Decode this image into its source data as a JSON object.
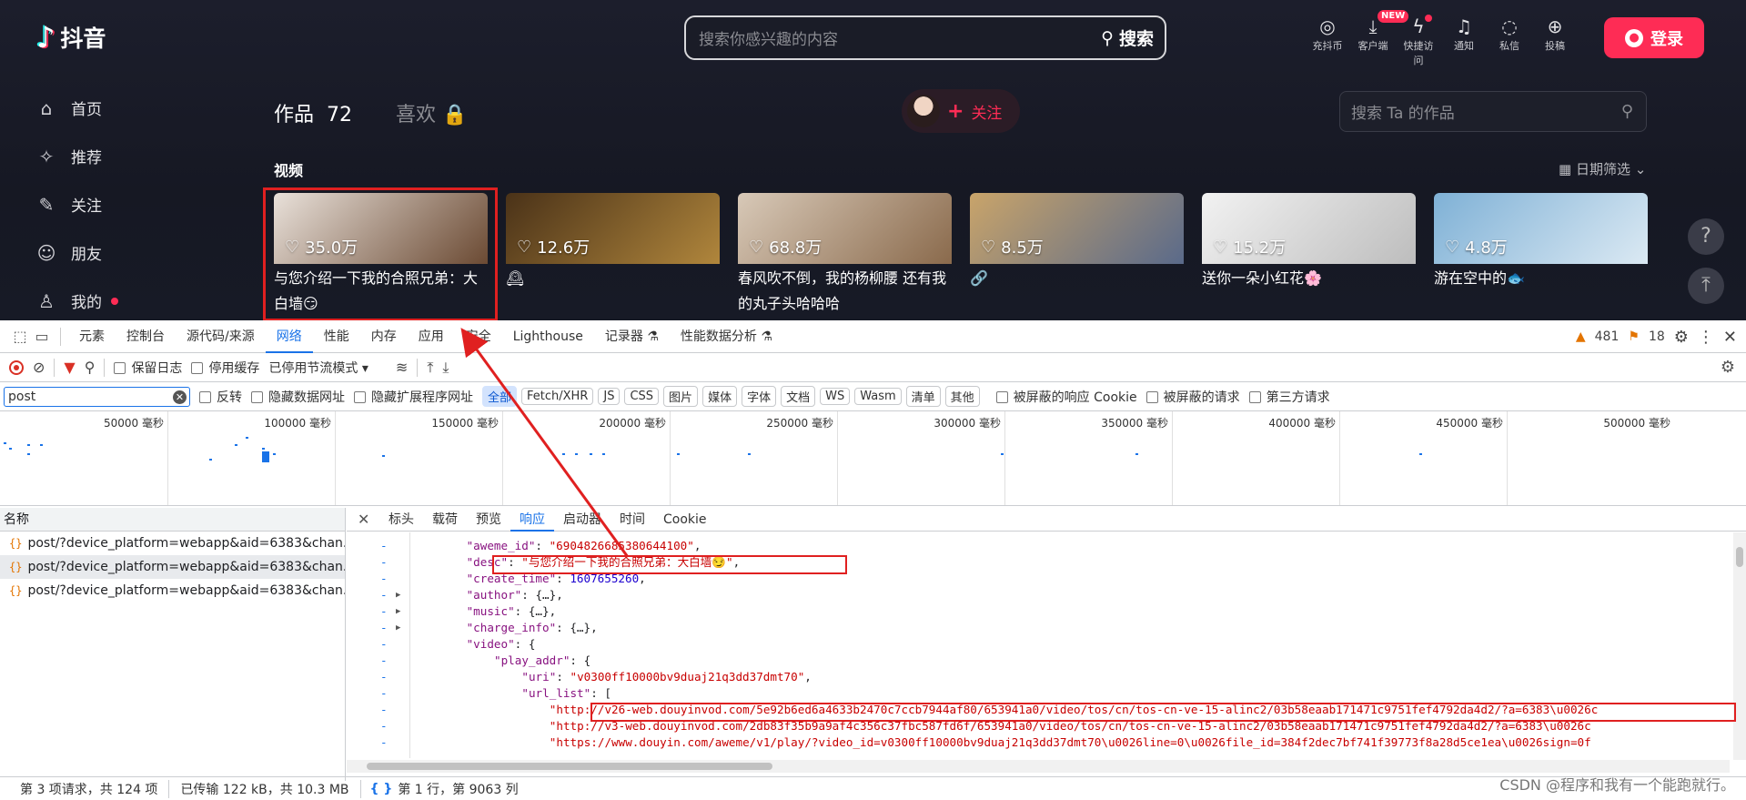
{
  "douyin": {
    "logo": "抖音",
    "search_placeholder": "搜索你感兴趣的内容",
    "search_button": "搜索",
    "top_icons": [
      {
        "icon": "coin-icon",
        "label": "充抖币",
        "glyph": "◎"
      },
      {
        "icon": "download-icon",
        "label": "客户端",
        "glyph": "⤓",
        "badge": "NEW"
      },
      {
        "icon": "lightning-icon",
        "label": "快捷访问",
        "glyph": "ϟ",
        "dot": true
      },
      {
        "icon": "bell-icon",
        "label": "通知",
        "glyph": "♫"
      },
      {
        "icon": "message-icon",
        "label": "私信",
        "glyph": "◌"
      },
      {
        "icon": "upload-icon",
        "label": "投稿",
        "glyph": "⊕"
      }
    ],
    "login_label": "登录",
    "nav": [
      {
        "icon": "home-icon",
        "glyph": "⌂",
        "label": "首页"
      },
      {
        "icon": "recommend-icon",
        "glyph": "✧",
        "label": "推荐"
      },
      {
        "icon": "follow-icon",
        "glyph": "✎",
        "label": "关注"
      },
      {
        "icon": "friends-icon",
        "glyph": "☺",
        "label": "朋友"
      },
      {
        "icon": "me-icon",
        "glyph": "♙",
        "label": "我的"
      }
    ],
    "tab_works": "作品",
    "tab_works_count": "72",
    "tab_likes": "喜欢",
    "follow_label": "关注",
    "works_search_placeholder": "搜索 Ta 的作品",
    "section_title": "视频",
    "date_filter": "日期筛选",
    "videos": [
      {
        "likes": "35.0万",
        "title": "与您介绍一下我的合照兄弟：大白墙😏",
        "colors": [
          "#e9e1da",
          "#6b4a33"
        ]
      },
      {
        "likes": "12.6万",
        "title": "🕰",
        "colors": [
          "#4a3218",
          "#b0863c"
        ]
      },
      {
        "likes": "68.8万",
        "title": "春风吹不倒，我的杨柳腰 还有我的丸子头哈哈哈",
        "colors": [
          "#d8c9b8",
          "#8a6a4c"
        ]
      },
      {
        "likes": "8.5万",
        "title": "🔗",
        "colors": [
          "#c9a46a",
          "#5a6a8a"
        ]
      },
      {
        "likes": "15.2万",
        "title": "送你一朵小红花🌸",
        "colors": [
          "#f2f2f2",
          "#bdbdbd"
        ]
      },
      {
        "likes": "4.8万",
        "title": "游在空中的🐟",
        "colors": [
          "#7fb1d6",
          "#dbe9f3"
        ]
      }
    ]
  },
  "devtools": {
    "main_tabs": [
      "元素",
      "控制台",
      "源代码/来源",
      "网络",
      "性能",
      "内存",
      "应用",
      "安全",
      "Lighthouse",
      "记录器 ⚗",
      "性能数据分析 ⚗"
    ],
    "active_main_tab": "网络",
    "warning_count": "481",
    "issue_count": "18",
    "preserve_log": "保留日志",
    "disable_cache": "停用缓存",
    "throttling": "已停用节流模式",
    "filter_value": "post",
    "invert": "反转",
    "hide_data_urls": "隐藏数据网址",
    "hide_ext_urls": "隐藏扩展程序网址",
    "type_filters": [
      "全部",
      "Fetch/XHR",
      "JS",
      "CSS",
      "图片",
      "媒体",
      "字体",
      "文档",
      "WS",
      "Wasm",
      "清单",
      "其他"
    ],
    "blocked_cookies": "被屏蔽的响应 Cookie",
    "blocked_requests": "被屏蔽的请求",
    "third_party": "第三方请求",
    "timeline_labels": [
      "50000 毫秒",
      "100000 毫秒",
      "150000 毫秒",
      "200000 毫秒",
      "250000 毫秒",
      "300000 毫秒",
      "350000 毫秒",
      "400000 毫秒",
      "450000 毫秒",
      "500000 毫秒"
    ],
    "name_header": "名称",
    "requests": [
      "post/?device_platform=webapp&aid=6383&chan...",
      "post/?device_platform=webapp&aid=6383&chan...",
      "post/?device_platform=webapp&aid=6383&chan..."
    ],
    "detail_tabs": [
      "标头",
      "载荷",
      "预览",
      "响应",
      "启动器",
      "时间",
      "Cookie"
    ],
    "active_detail_tab": "响应",
    "code_lines": [
      {
        "t": "[{\"k\":\"\\\"aweme_id\\\"\"},{\"p\":\": \"},{\"s\":\"\\\"6904826685380644100\\\"\"},{\"p\":\",\"}]"
      },
      {
        "t": ""
      }
    ],
    "status_requests": "第 3 项请求，共 124 项",
    "status_transferred": "已传输 122 kB，共 10.3 MB",
    "status_position": "第 1 行，第 9063 列"
  },
  "response_json": [
    {
      "indent": 6,
      "key": "\"aweme_id\"",
      "val": "\"6904826685380644100\"",
      "vtype": "s",
      "tail": ","
    },
    {
      "indent": 6,
      "key": "\"desc\"",
      "val": "\"与您介绍一下我的合照兄弟：大白墙😏\"",
      "vtype": "s",
      "tail": ","
    },
    {
      "indent": 6,
      "key": "\"create_time\"",
      "val": "1607655260",
      "vtype": "n",
      "tail": ","
    },
    {
      "indent": 6,
      "key": "\"author\"",
      "val": "{…}",
      "vtype": "p",
      "tail": ",",
      "tri": true
    },
    {
      "indent": 6,
      "key": "\"music\"",
      "val": "{…}",
      "vtype": "p",
      "tail": ",",
      "tri": true
    },
    {
      "indent": 6,
      "key": "\"charge_info\"",
      "val": "{…}",
      "vtype": "p",
      "tail": ",",
      "tri": true
    },
    {
      "indent": 6,
      "key": "\"video\"",
      "val": "{",
      "vtype": "p",
      "tail": ""
    },
    {
      "indent": 10,
      "key": "\"play_addr\"",
      "val": "{",
      "vtype": "p",
      "tail": ""
    },
    {
      "indent": 14,
      "key": "\"uri\"",
      "val": "\"v0300ff10000bv9duaj21q3dd37dmt70\"",
      "vtype": "s",
      "tail": ","
    },
    {
      "indent": 14,
      "key": "\"url_list\"",
      "val": "[",
      "vtype": "p",
      "tail": ""
    },
    {
      "indent": 18,
      "key": "",
      "val": "\"http://v26-web.douyinvod.com/5e92b6ed6a4633b2470c7ccb7944af80/653941a0/video/tos/cn/tos-cn-ve-15-alinc2/03b58eaab171471c9751fef4792da4d2/?a=6383\\u0026c",
      "vtype": "s",
      "tail": ""
    },
    {
      "indent": 18,
      "key": "",
      "val": "\"http://v3-web.douyinvod.com/2db83f35b9a9af4c356c37fbc587fd6f/653941a0/video/tos/cn/tos-cn-ve-15-alinc2/03b58eaab171471c9751fef4792da4d2/?a=6383\\u0026c",
      "vtype": "s",
      "tail": ""
    },
    {
      "indent": 18,
      "key": "",
      "val": "\"https://www.douyin.com/aweme/v1/play/?video_id=v0300ff10000bv9duaj21q3dd37dmt70\\u0026line=0\\u0026file_id=384f2dec7bf741f39773f8a28d5ce1ea\\u0026sign=0f",
      "vtype": "s",
      "tail": ""
    }
  ],
  "watermark": "CSDN @程序和我有一个能跑就行。"
}
